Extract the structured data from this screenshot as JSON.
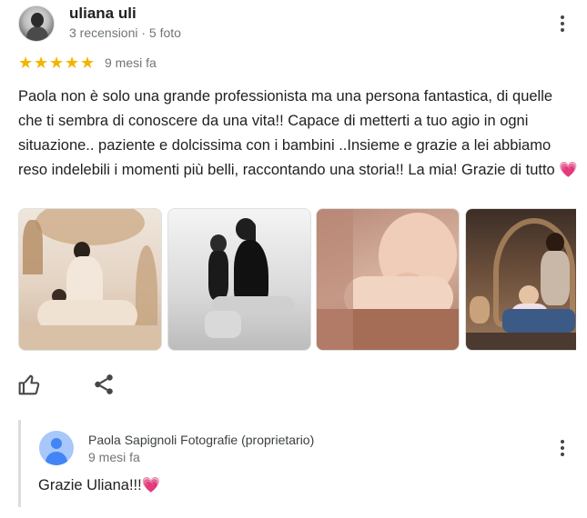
{
  "review": {
    "author": "uliana uli",
    "meta": "3 recensioni · 5 foto",
    "rating": 5,
    "stars": [
      "★",
      "★",
      "★",
      "★",
      "★"
    ],
    "time_ago": "9 mesi fa",
    "text": "Paola non è solo una grande professionista ma una persona fantastica, di quelle che ti sembra di conoscere da una vita!! Capace di metterti a tuo agio in ogni situazione.. paziente e dolcissima con i bambini ..Insieme e grazie a lei abbiamo reso indelebili i momenti più belli, raccontando una storia!! La mia! Grazie di tutto",
    "text_emoji": "💗",
    "photos_count": 4
  },
  "actions": {
    "like_icon": "thumb-up-outline",
    "share_icon": "share"
  },
  "reply": {
    "owner_name": "Paola Sapignoli Fotografie (proprietario)",
    "time_ago": "9 mesi fa",
    "text": "Grazie Uliana!!!",
    "text_emoji": "💗"
  },
  "colors": {
    "star": "#f4b400",
    "secondary_text": "#70757a",
    "owner_avatar_bg": "#a8c7fa",
    "owner_avatar_fg": "#4285f4",
    "heart": "#ec6fae"
  }
}
